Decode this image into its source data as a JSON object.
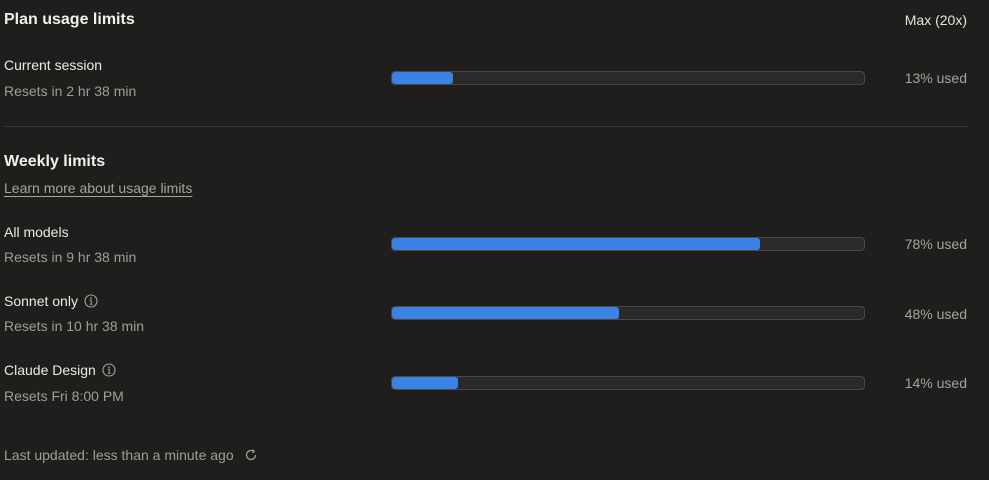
{
  "header": {
    "title": "Plan usage limits",
    "plan": "Max (20x)"
  },
  "session": {
    "label": "Current session",
    "resets": "Resets in 2 hr 38 min",
    "percent": 13,
    "used_text": "13% used"
  },
  "weekly": {
    "title": "Weekly limits",
    "learn_more": "Learn more about usage limits",
    "rows": [
      {
        "label": "All models",
        "resets": "Resets in 9 hr 38 min",
        "percent": 78,
        "used_text": "78% used",
        "info": false
      },
      {
        "label": "Sonnet only",
        "resets": "Resets in 10 hr 38 min",
        "percent": 48,
        "used_text": "48% used",
        "info": true
      },
      {
        "label": "Claude Design",
        "resets": "Resets Fri 8:00 PM",
        "percent": 14,
        "used_text": "14% used",
        "info": true
      }
    ]
  },
  "footer": {
    "last_updated": "Last updated: less than a minute ago"
  },
  "colors": {
    "background": "#1f1e1d",
    "bar_fill": "#3a82e6",
    "bar_track": "#2b2a28"
  },
  "icons": {
    "info": "info-circle-icon",
    "refresh": "refresh-icon"
  }
}
